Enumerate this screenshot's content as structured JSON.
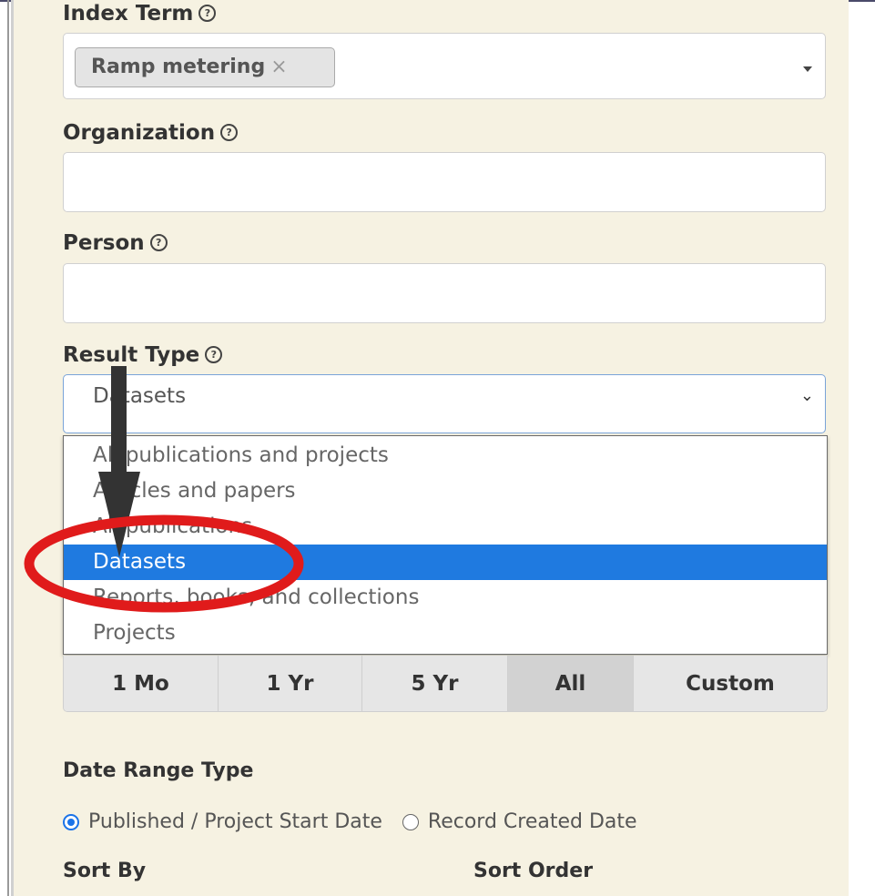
{
  "fields": {
    "index_term": {
      "label": "Index Term",
      "tag": "Ramp metering",
      "tag_remove": "×"
    },
    "organization": {
      "label": "Organization",
      "value": ""
    },
    "person": {
      "label": "Person",
      "value": ""
    },
    "result_type": {
      "label": "Result Type",
      "selected": "Datasets",
      "options": [
        "All publications and projects",
        "Articles and papers",
        "All publications",
        "Datasets",
        "Reports, books, and collections",
        "Projects"
      ],
      "selected_index": 3
    }
  },
  "date_range": {
    "buttons": [
      "1 Mo",
      "1 Yr",
      "5 Yr",
      "All",
      "Custom"
    ],
    "active": "All"
  },
  "date_range_type": {
    "label": "Date Range Type",
    "options": [
      "Published / Project Start Date",
      "Record Created Date"
    ],
    "selected": "Published / Project Start Date"
  },
  "sort": {
    "sort_by_label": "Sort By",
    "sort_order_label": "Sort Order"
  },
  "colors": {
    "accent": "#1f7ae0",
    "panel": "#f6f2e2",
    "annotation_circle": "#e01b1b",
    "annotation_arrow": "#333333"
  },
  "help_glyph": "?"
}
